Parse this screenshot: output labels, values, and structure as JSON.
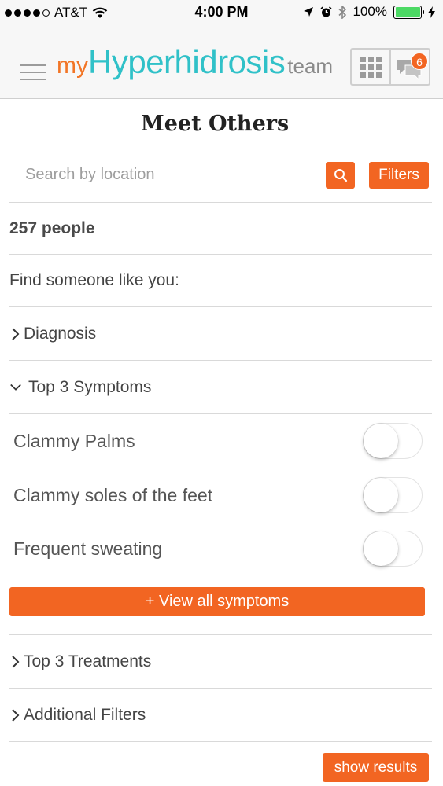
{
  "status_bar": {
    "carrier": "AT&T",
    "time": "4:00 PM",
    "battery": "100%"
  },
  "header": {
    "logo_my": "my",
    "logo_brand": "Hyperhidrosis",
    "logo_team": "team",
    "messages_badge": "6"
  },
  "page": {
    "title": "Meet Others"
  },
  "search": {
    "placeholder": "Search by location",
    "filters_label": "Filters"
  },
  "results": {
    "count": "257 people"
  },
  "find": {
    "label": "Find someone like you:"
  },
  "sections": {
    "diagnosis": "Diagnosis",
    "symptoms": "Top 3 Symptoms",
    "treatments": "Top 3 Treatments",
    "additional": "Additional Filters"
  },
  "symptoms": [
    {
      "label": "Clammy Palms",
      "on": false
    },
    {
      "label": "Clammy soles of the feet",
      "on": false
    },
    {
      "label": "Frequent sweating",
      "on": false
    }
  ],
  "buttons": {
    "view_all": "+ View all symptoms",
    "show_results": "show results"
  },
  "colors": {
    "accent": "#f26522",
    "brand_teal": "#30c1c8",
    "brand_orange": "#f27526"
  }
}
